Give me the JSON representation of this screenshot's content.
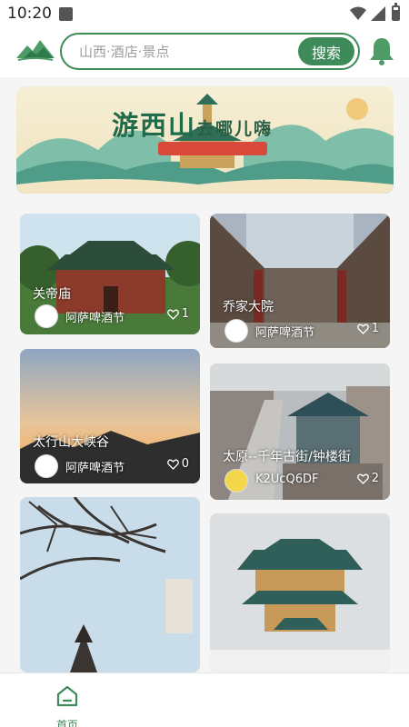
{
  "status_bar": {
    "time": "10:20"
  },
  "header": {
    "search_placeholder": "山西·酒店·景点",
    "search_button": "搜索"
  },
  "banner": {
    "title_main": "游西山",
    "title_rest": "去哪儿嗨"
  },
  "cards": [
    {
      "title": "关帝庙",
      "author": "阿萨啤酒节",
      "likes": "1"
    },
    {
      "title": "乔家大院",
      "author": "阿萨啤酒节",
      "likes": "1"
    },
    {
      "title": "太行山大峡谷",
      "author": "阿萨啤酒节",
      "likes": "0"
    },
    {
      "title": "太原--千年古街/钟楼街",
      "author": "K2UcQ6DF",
      "likes": "2"
    },
    {
      "title": "",
      "author": "",
      "likes": ""
    },
    {
      "title": "",
      "author": "",
      "likes": ""
    }
  ],
  "bottom_nav": {
    "home_label": "首页"
  },
  "colors": {
    "accent": "#3e8a58",
    "banner_title": "#1f6b4a"
  },
  "icons": [
    "logo-mountain-icon",
    "bell-icon",
    "heart-outline-icon",
    "home-icon",
    "wifi-icon",
    "signal-icon",
    "battery-icon"
  ]
}
